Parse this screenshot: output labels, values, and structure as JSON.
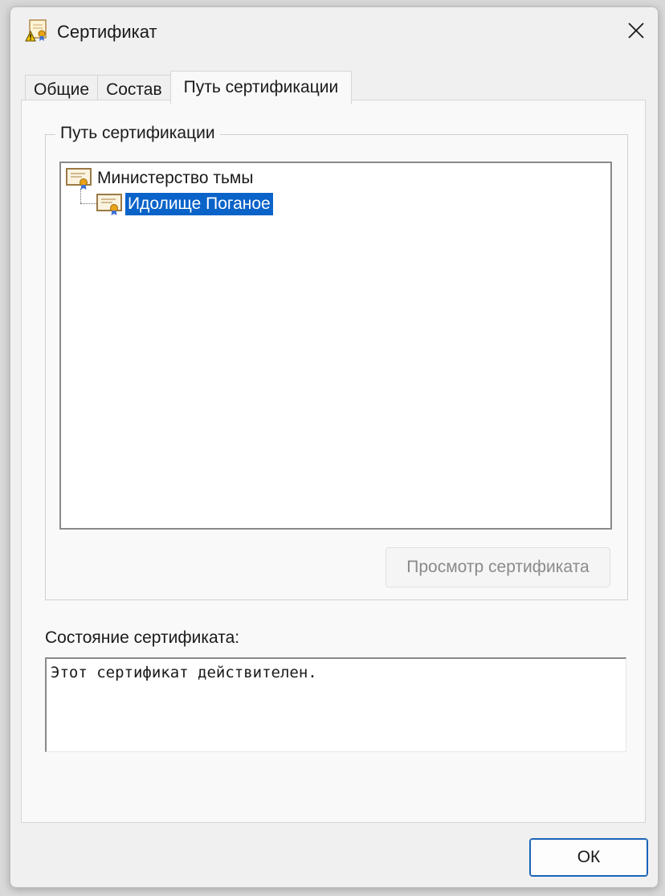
{
  "window": {
    "title": "Сертификат",
    "icon": "certificate-warning-icon"
  },
  "tabs": [
    {
      "label": "Общие",
      "active": false
    },
    {
      "label": "Состав",
      "active": false
    },
    {
      "label": "Путь сертификации",
      "active": true
    }
  ],
  "path_group": {
    "label": "Путь сертификации",
    "tree": [
      {
        "label": "Министерство тьмы",
        "icon": "certificate-icon",
        "level": 0,
        "selected": false
      },
      {
        "label": "Идолище Поганое",
        "icon": "certificate-icon",
        "level": 1,
        "selected": true
      }
    ],
    "view_button_label": "Просмотр сертификата"
  },
  "status": {
    "label": "Состояние сертификата:",
    "text": "Этот сертификат действителен."
  },
  "ok_label": "ОК",
  "colors": {
    "selection": "#0a63c9",
    "ok_border": "#1a64b8",
    "disabled_text": "#8a8a8a"
  }
}
